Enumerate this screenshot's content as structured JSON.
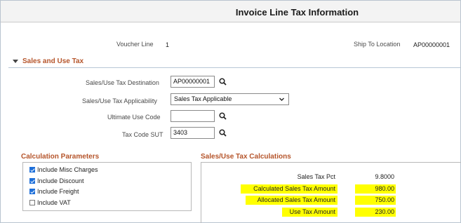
{
  "page": {
    "title": "Invoice Line Tax Information"
  },
  "header": {
    "voucher_line_label": "Voucher Line",
    "voucher_line_value": "1",
    "ship_to_label": "Ship To Location",
    "ship_to_value": "AP00000001"
  },
  "section": {
    "title": "Sales and Use Tax"
  },
  "form": {
    "destination_label": "Sales/Use Tax Destination",
    "destination_value": "AP00000001",
    "applicability_label": "Sales/Use Tax Applicability",
    "applicability_value": "Sales Tax Applicable",
    "ultimate_use_label": "Ultimate Use Code",
    "ultimate_use_value": "",
    "tax_code_label": "Tax Code SUT",
    "tax_code_value": "3403"
  },
  "calc_params": {
    "title": "Calculation Parameters",
    "items": [
      {
        "label": "Include Misc Charges",
        "checked": true
      },
      {
        "label": "Include Discount",
        "checked": true
      },
      {
        "label": "Include Freight",
        "checked": true
      },
      {
        "label": "Include VAT",
        "checked": false
      }
    ]
  },
  "calculations": {
    "title": "Sales/Use Tax Calculations",
    "rows": [
      {
        "label": "Sales Tax Pct",
        "value": "9.8000",
        "highlighted": false
      },
      {
        "label": "Calculated Sales Tax Amount",
        "value": "980.00",
        "highlighted": true
      },
      {
        "label": "Allocated Sales Tax Amount",
        "value": "750.00",
        "highlighted": true
      },
      {
        "label": "Use Tax Amount",
        "value": "230.00",
        "highlighted": true
      }
    ]
  },
  "colors": {
    "section_title": "#b5542a",
    "highlight": "#ffff00",
    "checkbox": "#1e6fd9"
  },
  "icons": {
    "lookup": "search-icon",
    "dropdown": "chevron-down-icon",
    "collapse": "triangle-down-icon"
  }
}
